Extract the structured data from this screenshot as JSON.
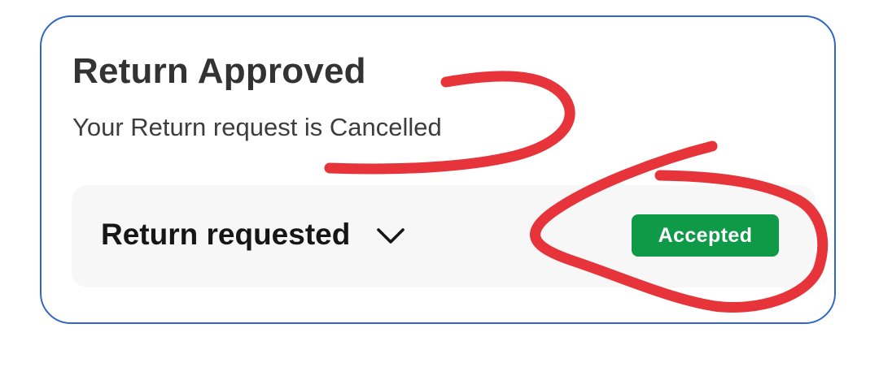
{
  "card": {
    "title": "Return Approved",
    "subtitle": "Your Return request is Cancelled"
  },
  "status": {
    "label": "Return requested",
    "chevron_icon": "chevron-down-icon",
    "badge": "Accepted"
  },
  "colors": {
    "card_border": "#2f66c6",
    "badge_bg": "#0f9a48",
    "row_bg": "#f7f7f7",
    "annotation": "#e6343a"
  }
}
